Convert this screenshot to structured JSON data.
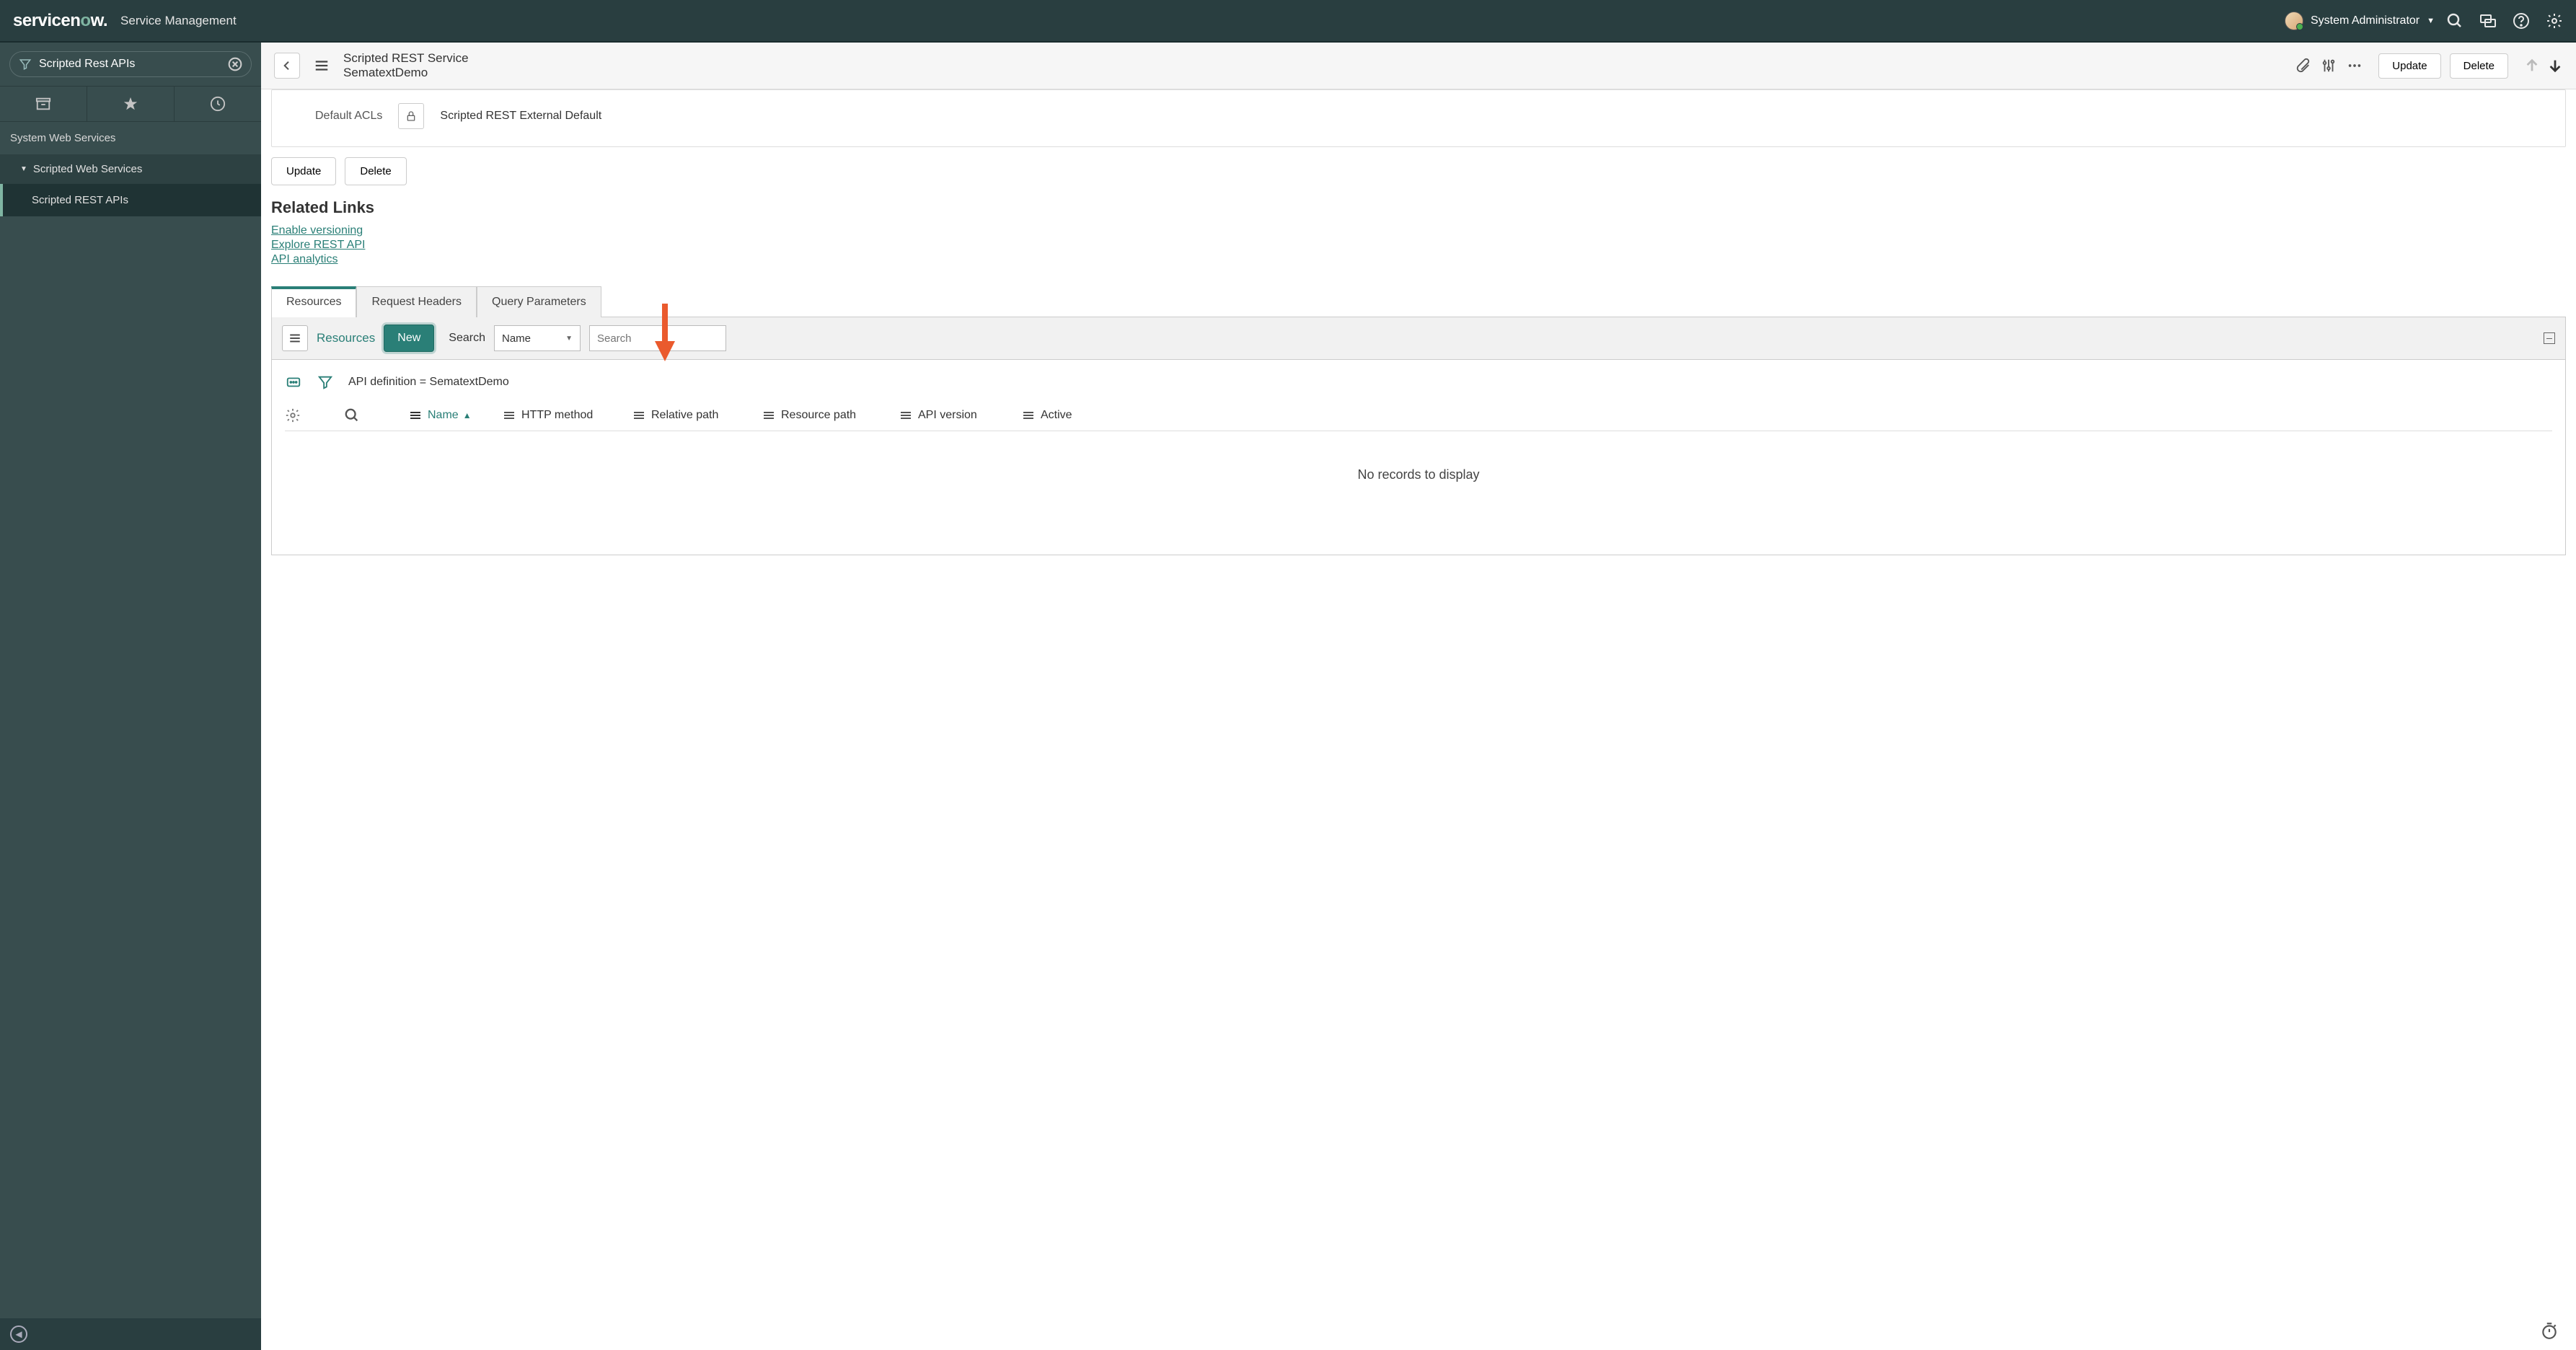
{
  "banner": {
    "logo_prefix": "servicen",
    "logo_suffix": "w.",
    "app_name": "Service Management",
    "user_name": "System Administrator"
  },
  "sidebar": {
    "filter_value": "Scripted Rest APIs",
    "section": "System Web Services",
    "group": "Scripted Web Services",
    "item": "Scripted REST APIs"
  },
  "form_header": {
    "title_line1": "Scripted REST Service",
    "title_line2": "SematextDemo",
    "update": "Update",
    "delete": "Delete"
  },
  "acls": {
    "label": "Default ACLs",
    "value": "Scripted REST External Default"
  },
  "buttons": {
    "update": "Update",
    "delete": "Delete"
  },
  "related": {
    "title": "Related Links",
    "links": [
      "Enable versioning",
      "Explore REST API",
      "API analytics"
    ]
  },
  "tabs": [
    "Resources",
    "Request Headers",
    "Query Parameters"
  ],
  "list_toolbar": {
    "title": "Resources",
    "new": "New",
    "search_label": "Search",
    "select_value": "Name",
    "search_placeholder": "Search"
  },
  "breadcrumb": "API definition = SematextDemo",
  "columns": [
    "Name",
    "HTTP method",
    "Relative path",
    "Resource path",
    "API version",
    "Active"
  ],
  "no_records": "No records to display"
}
